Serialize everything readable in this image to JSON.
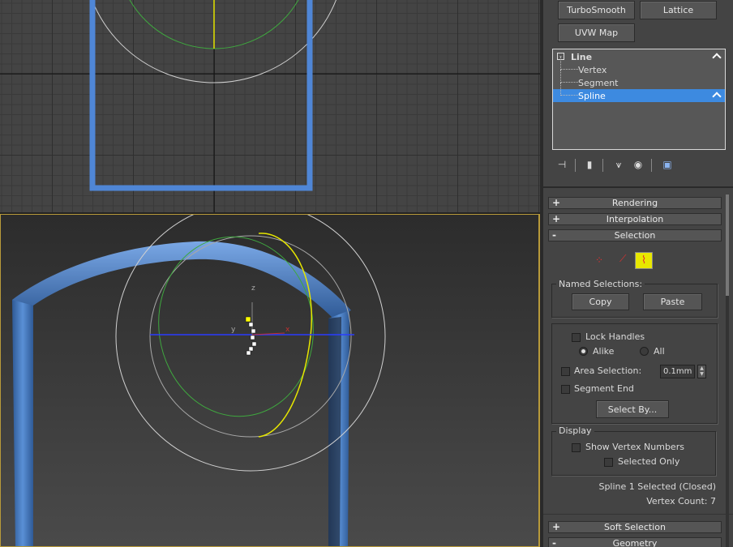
{
  "modifier_buttons": {
    "turbosmooth": "TurboSmooth",
    "lattice": "Lattice",
    "uvw_map": "UVW Map"
  },
  "stack": {
    "root": "Line",
    "items": [
      {
        "label": "Vertex",
        "selected": false
      },
      {
        "label": "Segment",
        "selected": false
      },
      {
        "label": "Spline",
        "selected": true
      }
    ]
  },
  "rollouts": {
    "rendering": {
      "label": "Rendering",
      "sign": "+"
    },
    "interpolation": {
      "label": "Interpolation",
      "sign": "+"
    },
    "selection": {
      "label": "Selection",
      "sign": "-"
    },
    "soft_selection": {
      "label": "Soft Selection",
      "sign": "+"
    },
    "geometry": {
      "label": "Geometry",
      "sign": "-"
    }
  },
  "named_selections": {
    "title": "Named Selections:",
    "copy": "Copy",
    "paste": "Paste"
  },
  "selection_options": {
    "lock_handles": "Lock Handles",
    "alike": "Alike",
    "all": "All",
    "area_selection": "Area Selection:",
    "area_value": "0.1mm",
    "segment_end": "Segment End",
    "select_by": "Select By..."
  },
  "display": {
    "title": "Display",
    "show_vertex_numbers": "Show Vertex Numbers",
    "selected_only": "Selected Only"
  },
  "status": {
    "selected": "Spline 1 Selected (Closed)",
    "vertex_count": "Vertex Count: 7"
  },
  "gizmo_labels": {
    "z": "z",
    "y": "y",
    "x": "x"
  },
  "colors": {
    "spline_blue": "#4f86d6",
    "selection_highlight": "#3d8ae0",
    "circle_yellow": "#e6e600",
    "circle_green": "#3fa83f",
    "active_border": "#b89a3a"
  }
}
